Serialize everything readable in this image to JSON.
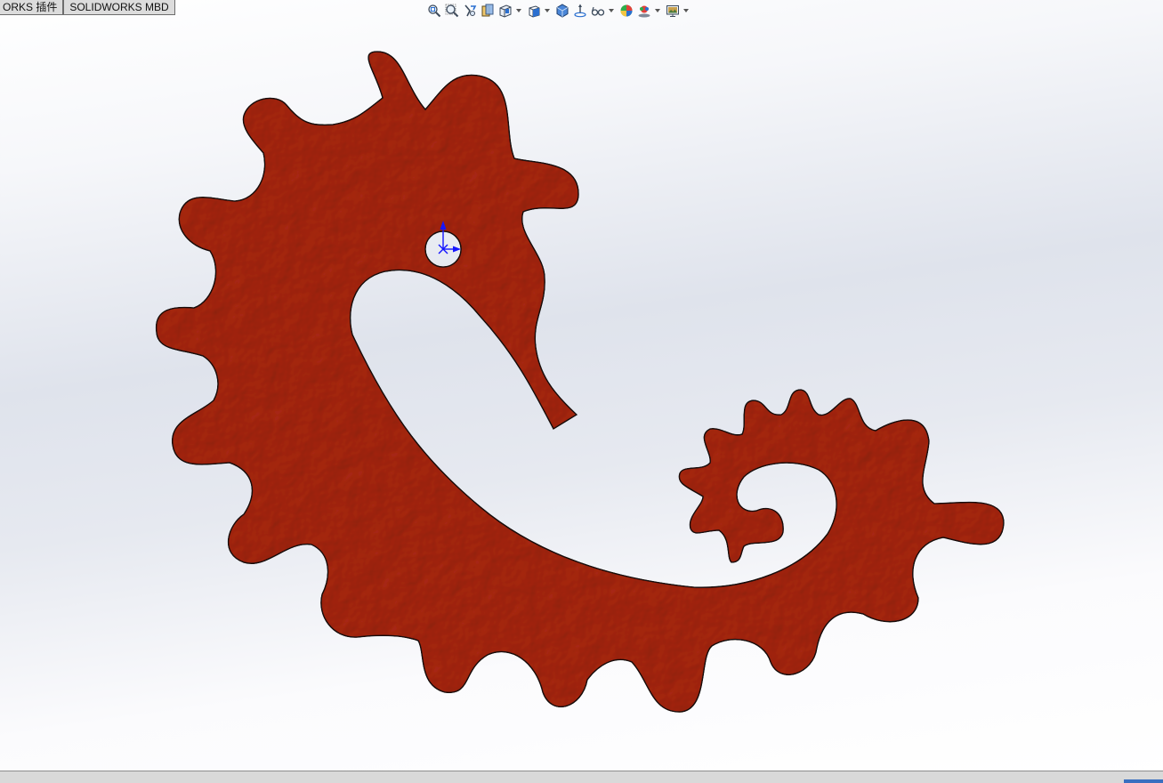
{
  "tabs": [
    {
      "label": "ORKS 插件"
    },
    {
      "label": "SOLIDWORKS MBD"
    }
  ],
  "toolbar": {
    "icons": [
      "zoom-to-fit-icon",
      "zoom-to-area-icon",
      "previous-view-icon",
      "section-view-icon",
      "dynamic-annotation-views-icon",
      "view-orientation-icon",
      "display-style-icon",
      "hide-show-items-icon",
      "edit-appearance-icon",
      "apply-scene-icon",
      "view-settings-icon"
    ]
  },
  "colors": {
    "part_fill": "#a72612",
    "part_edge": "#1a0a08",
    "triad_blue": "#1515ff"
  }
}
